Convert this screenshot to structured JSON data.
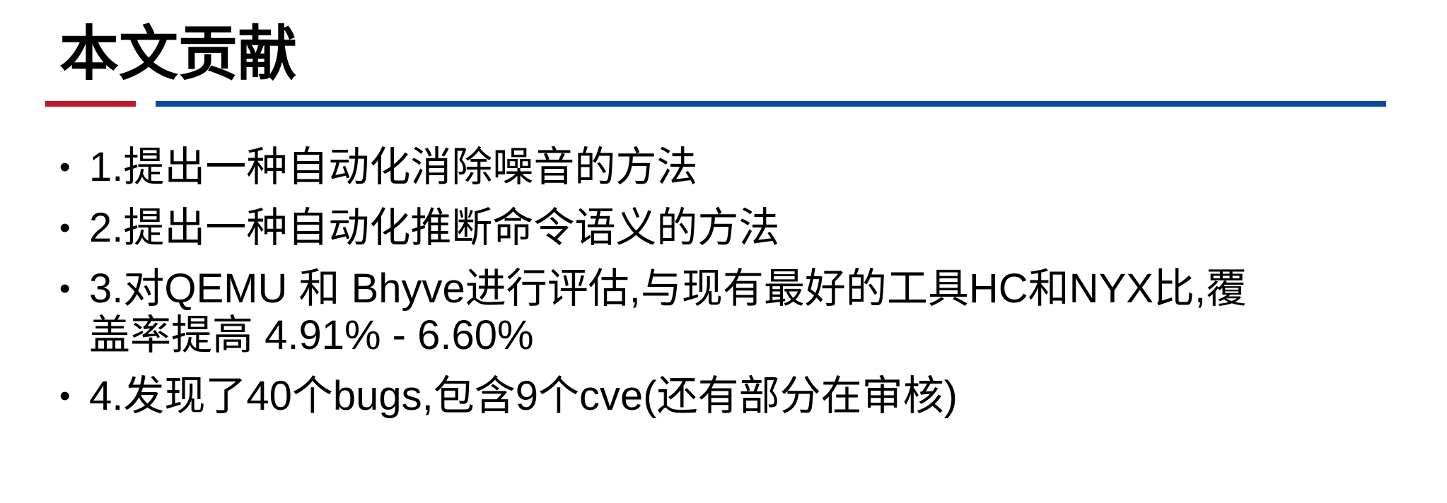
{
  "slide": {
    "title": "本文贡献",
    "accent_color": "#c0192a",
    "rule_color": "#0b4a9e",
    "bullet_glyph": "•"
  },
  "contributions": [
    {
      "lines": [
        "1.提出一种自动化消除噪音的方法"
      ]
    },
    {
      "lines": [
        "2.提出一种自动化推断命令语义的方法"
      ]
    },
    {
      "lines": [
        "3.对QEMU 和 Bhyve进行评估,与现有最好的工具HC和NYX比,覆",
        "盖率提高 4.91% - 6.60%"
      ]
    },
    {
      "lines": [
        "4.发现了40个bugs,包含9个cve(还有部分在审核)"
      ]
    }
  ]
}
